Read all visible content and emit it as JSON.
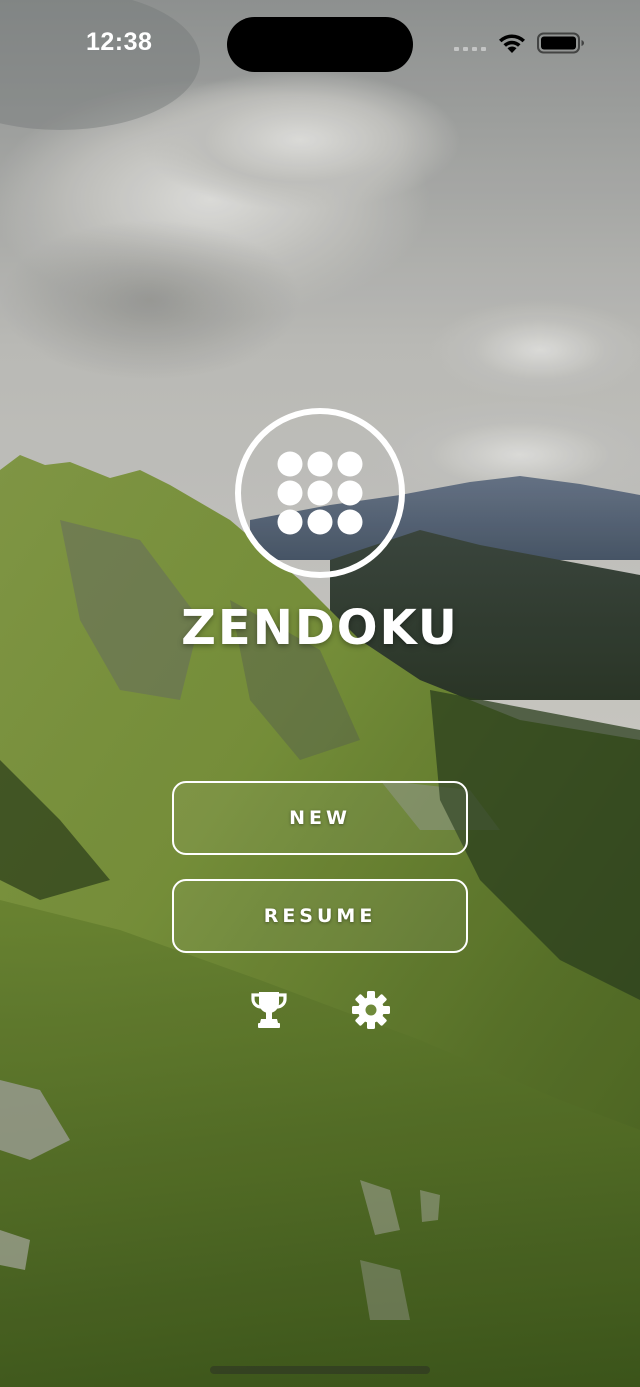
{
  "status_bar": {
    "time": "12:38",
    "icons": [
      "signal-icon",
      "wifi-icon",
      "battery-icon"
    ]
  },
  "app": {
    "logo_icon": "dice-nine-dots-icon",
    "title": "ZENDOKU"
  },
  "menu": {
    "new_label": "NEW",
    "resume_label": "RESUME"
  },
  "bottom_icons": {
    "leaderboard_icon": "trophy-icon",
    "settings_icon": "gear-icon"
  },
  "colors": {
    "text": "#ffffff",
    "button_border": "#ffffff",
    "sky": "#cfd0cc",
    "meadow": "#7e9c3c"
  }
}
